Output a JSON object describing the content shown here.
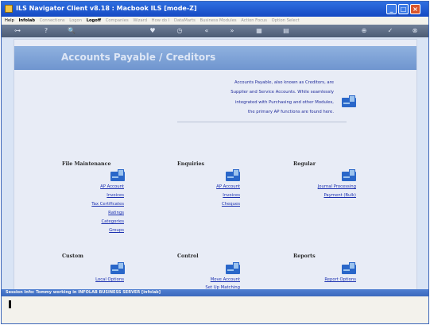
{
  "window": {
    "title": "ILS Navigator Client v8.18 : Macbook ILS      [mode-Z]",
    "buttons": {
      "minimize": "_",
      "maximize": "□",
      "close": "×"
    }
  },
  "menu": {
    "items": [
      {
        "label": "Help",
        "active": true
      },
      {
        "label": "Infolab",
        "active": true
      },
      {
        "label": "Connections",
        "active": false
      },
      {
        "label": "Logon",
        "active": false
      },
      {
        "label": "Logoff",
        "active": true
      },
      {
        "label": "Companies",
        "active": false
      },
      {
        "label": "Wizard",
        "active": false
      },
      {
        "label": "How do I",
        "active": false
      },
      {
        "label": "DataMarts",
        "active": false
      },
      {
        "label": "Business Modules",
        "active": false
      },
      {
        "label": "Action Focus",
        "active": false
      },
      {
        "label": "Option Select",
        "active": false
      }
    ]
  },
  "toolbar": {
    "key_icon": "⊶",
    "help_icon": "?",
    "search_icon": "🔍",
    "heart_icon": "♥",
    "clock_icon": "◷",
    "back_icon": "«",
    "forward_icon": "»",
    "grid_icon": "▦",
    "doc_icon": "▤",
    "add_icon": "⊕",
    "check_icon": "✓",
    "close_icon": "⊗"
  },
  "banner": {
    "title": "Accounts Payable / Creditors"
  },
  "intro": {
    "lines": [
      "Accounts Payable, also known as Creditors, are",
      "Supplier and Service Accounts. While seamlessly",
      "integrated with Purchasing and other Modules,",
      "the primary AP functions are found here."
    ]
  },
  "sections": {
    "file_maintenance": {
      "title": "File Maintenance",
      "links": [
        "AP Account",
        "Invoices",
        "Tax Certificates",
        "Ratings",
        "Categories",
        "Groups"
      ]
    },
    "enquiries": {
      "title": "Enquiries",
      "links": [
        "AP Account",
        "Invoices",
        "Cheques"
      ]
    },
    "regular": {
      "title": "Regular",
      "links": [
        "Journal Processing",
        "Payment (Bulk)"
      ]
    },
    "custom": {
      "title": "Custom",
      "links": [
        "Local Options"
      ]
    },
    "control": {
      "title": "Control",
      "links": [
        "Move Account",
        "Set Up Matching"
      ]
    },
    "reports": {
      "title": "Reports",
      "links": [
        "Report Options"
      ]
    }
  },
  "status": {
    "text": "Session Info: Tommy working in INFOLAB BUSINESS SERVER   [infolab]"
  },
  "colors": {
    "titlebar": "#1549c3",
    "banner": "#7fa3d8",
    "link": "#1a2fb0",
    "content_bg": "#e8ecf6"
  }
}
